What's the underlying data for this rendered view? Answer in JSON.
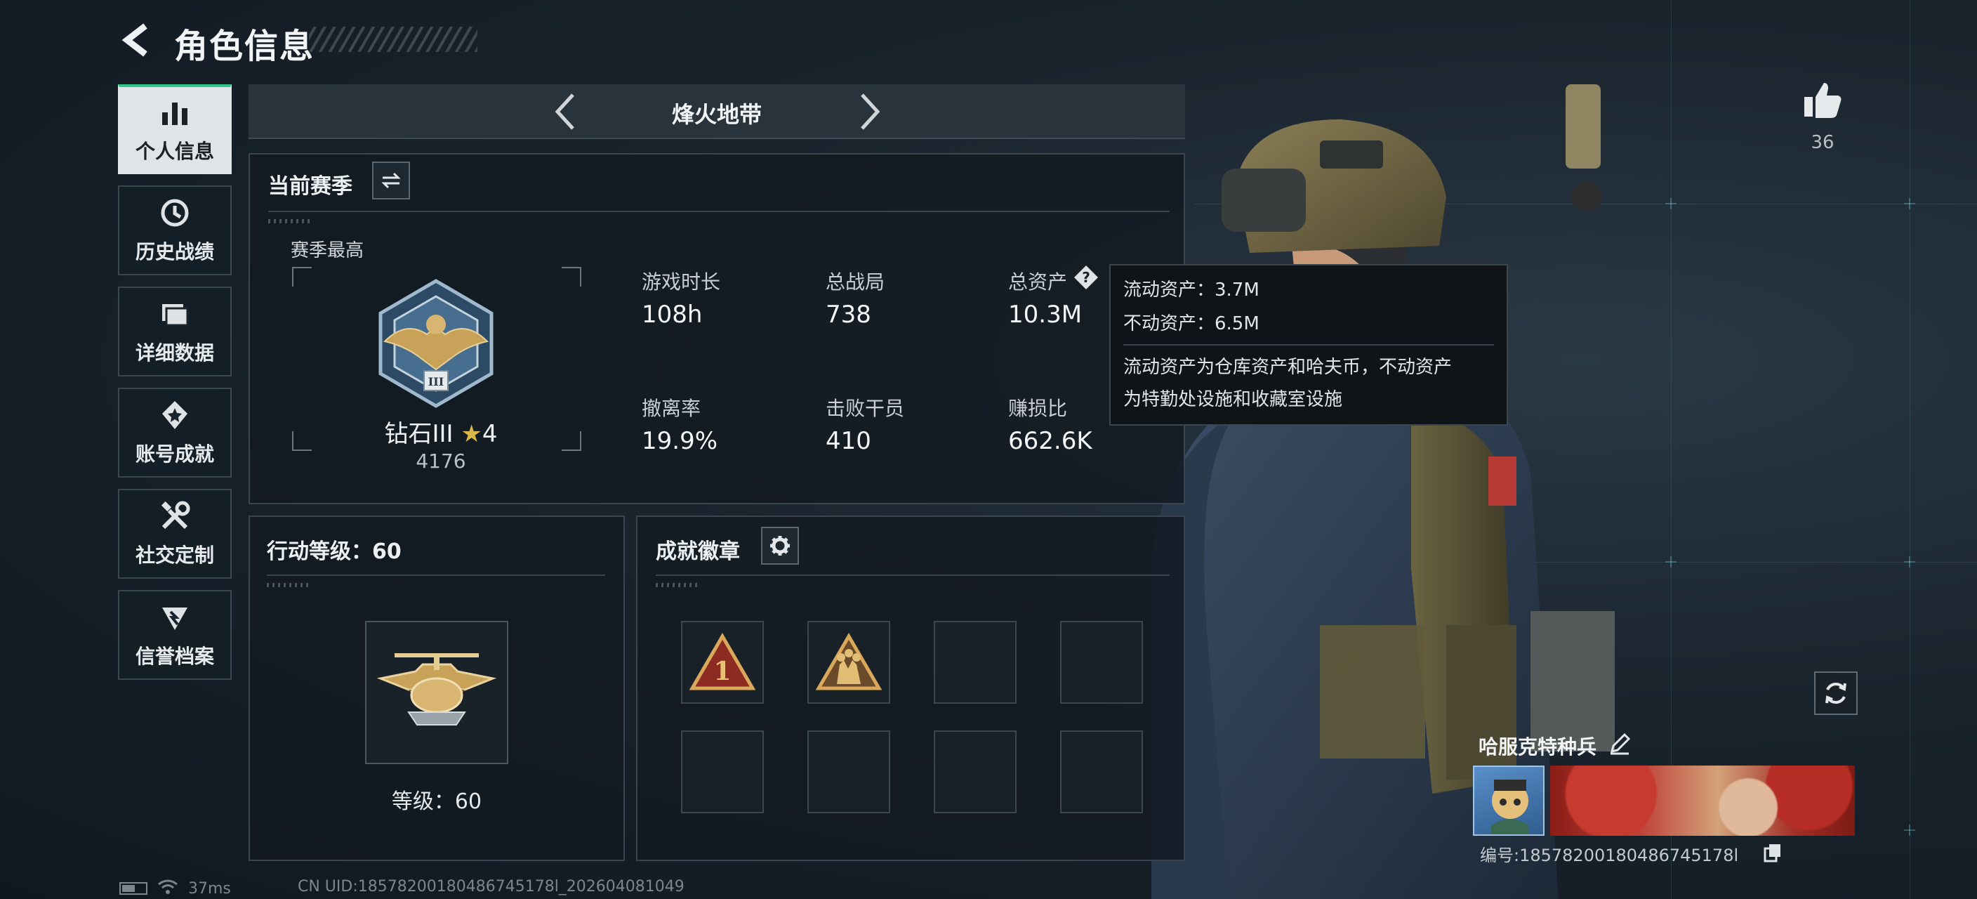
{
  "header": {
    "title": "角色信息"
  },
  "sidebar": {
    "items": [
      {
        "label": "个人信息",
        "icon": "bar-chart-icon",
        "active": true
      },
      {
        "label": "历史战绩",
        "icon": "history-icon",
        "active": false
      },
      {
        "label": "详细数据",
        "icon": "folder-icon",
        "active": false
      },
      {
        "label": "账号成就",
        "icon": "achievement-icon",
        "active": false
      },
      {
        "label": "社交定制",
        "icon": "tools-icon",
        "active": false
      },
      {
        "label": "信誉档案",
        "icon": "reputation-icon",
        "active": false
      }
    ]
  },
  "mode": {
    "title": "烽火地带"
  },
  "season": {
    "heading": "当前赛季",
    "best_label": "赛季最高",
    "rank_name": "钻石III",
    "rank_stars": "4",
    "rank_score": "4176",
    "stats": [
      {
        "label": "游戏时长",
        "value": "108h"
      },
      {
        "label": "总战局",
        "value": "738"
      },
      {
        "label": "总资产",
        "value": "10.3M"
      },
      {
        "label": "撤离率",
        "value": "19.9%"
      },
      {
        "label": "击败干员",
        "value": "410"
      },
      {
        "label": "赚损比",
        "value": "662.6K"
      }
    ]
  },
  "tooltip": {
    "line1": "流动资产：3.7M",
    "line2": "不动资产：6.5M",
    "desc1": "流动资产为仓库资产和哈夫币，不动资产",
    "desc2": "为特勤处设施和收藏室设施"
  },
  "action_level": {
    "heading": "行动等级：60",
    "level_text": "等级：60"
  },
  "badges": {
    "heading": "成就徽章",
    "slots": 8,
    "filled": [
      "rank-1-badge",
      "squad-badge"
    ]
  },
  "player": {
    "likes": "36",
    "name": "哈服克特种兵",
    "id_text": "编号:18578200180486745178l"
  },
  "status": {
    "ping": "37ms",
    "uid": "CN UID:18578200180486745178l_202604081049"
  },
  "colors": {
    "accent": "#33c48a",
    "gold": "#c9a25a",
    "panel_border": "#3a454f"
  }
}
